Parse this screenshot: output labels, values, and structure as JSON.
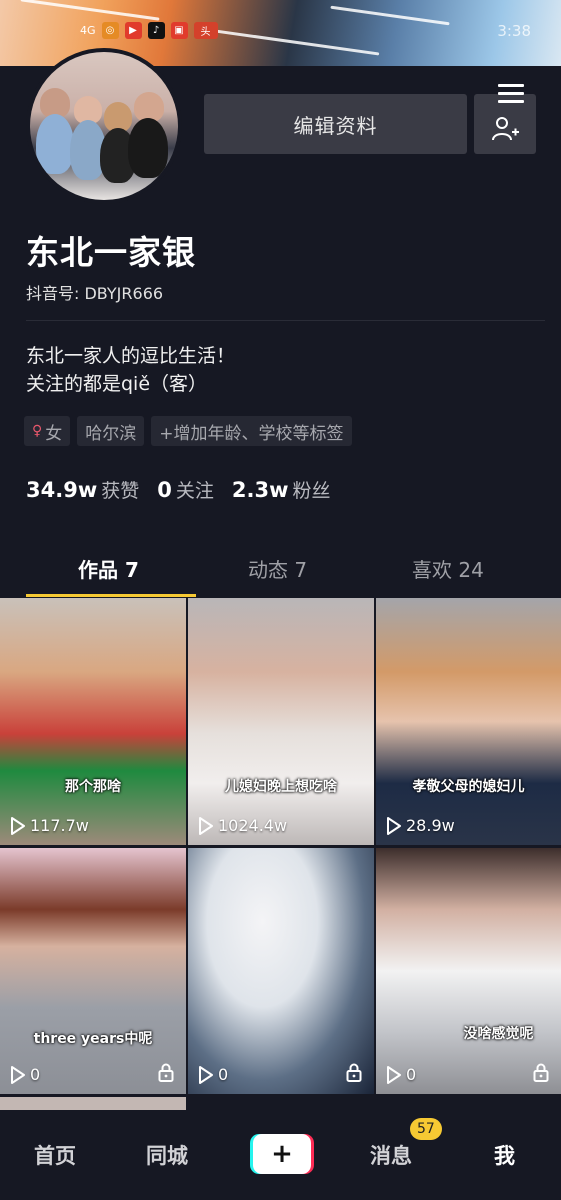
{
  "status_bar": {
    "signal": "4G",
    "app_icons": [
      "app-icon-1",
      "app-icon-2",
      "app-icon-3",
      "douyin-icon",
      "app-icon-5",
      "toutiao-icon"
    ],
    "time": "3:38"
  },
  "profile": {
    "name": "东北一家银",
    "douyin_id": "抖音号: DBYJR666",
    "edit_label": "编辑资料",
    "bio_line1": "东北一家人的逗比生活！",
    "bio_line2": "关注的都是qiě（客）",
    "tags": [
      "女",
      "哈尔滨",
      "+增加年龄、学校等标签"
    ],
    "stats": [
      {
        "value": "34.9w",
        "label": "获赞"
      },
      {
        "value": "0",
        "label": "关注"
      },
      {
        "value": "2.3w",
        "label": "粉丝"
      }
    ]
  },
  "tabs": [
    {
      "label": "作品 7",
      "active": true
    },
    {
      "label": "动态 7",
      "active": false
    },
    {
      "label": "喜欢 24",
      "active": false
    }
  ],
  "videos": [
    {
      "views": "117.7w",
      "caption": "那个那啥",
      "locked": false
    },
    {
      "views": "1024.4w",
      "caption": "儿媳妇晚上想吃啥",
      "locked": false
    },
    {
      "views": "28.9w",
      "caption": "孝敬父母的媳妇儿",
      "locked": false
    },
    {
      "views": "0",
      "caption": "three years中呢",
      "locked": true
    },
    {
      "views": "0",
      "caption": "",
      "locked": true
    },
    {
      "views": "0",
      "caption": "没啥感觉呢",
      "locked": true
    }
  ],
  "nav": {
    "home": "首页",
    "nearby": "同城",
    "add": "+",
    "messages": "消息",
    "messages_badge": "57",
    "me": "我"
  },
  "colors": {
    "background": "#161823",
    "accent_yellow": "#f6c933",
    "tiktok_cyan": "#25f4ee",
    "tiktok_red": "#fe2c55"
  }
}
